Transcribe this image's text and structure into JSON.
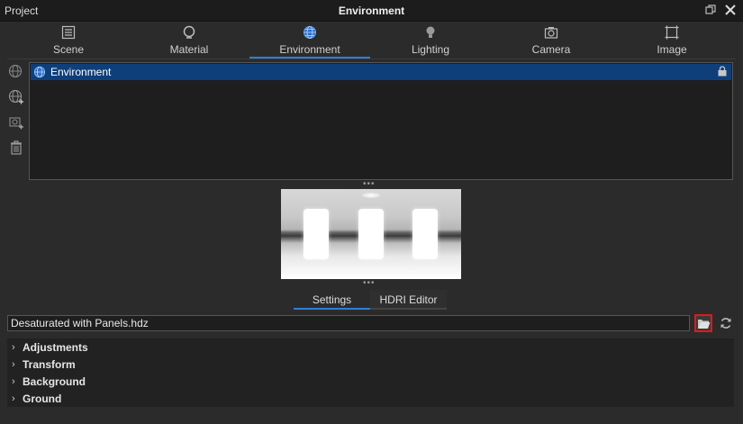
{
  "window": {
    "left_label": "Project",
    "title": "Environment"
  },
  "tabs": [
    {
      "label": "Scene",
      "icon": "scene-icon"
    },
    {
      "label": "Material",
      "icon": "material-icon"
    },
    {
      "label": "Environment",
      "icon": "globe-icon",
      "active": true
    },
    {
      "label": "Lighting",
      "icon": "bulb-icon"
    },
    {
      "label": "Camera",
      "icon": "camera-icon"
    },
    {
      "label": "Image",
      "icon": "image-icon"
    }
  ],
  "environment_list": {
    "items": [
      {
        "name": "Environment",
        "selected": true
      }
    ]
  },
  "subtabs": [
    {
      "label": "Settings",
      "active": true
    },
    {
      "label": "HDRI Editor",
      "active": false
    }
  ],
  "file": {
    "value": "Desaturated with Panels.hdz"
  },
  "sections": [
    {
      "label": "Adjustments"
    },
    {
      "label": "Transform"
    },
    {
      "label": "Background"
    },
    {
      "label": "Ground"
    }
  ],
  "colors": {
    "accent": "#2f7ed8",
    "selection": "#0e3f7a",
    "highlight_border": "#e01919"
  }
}
